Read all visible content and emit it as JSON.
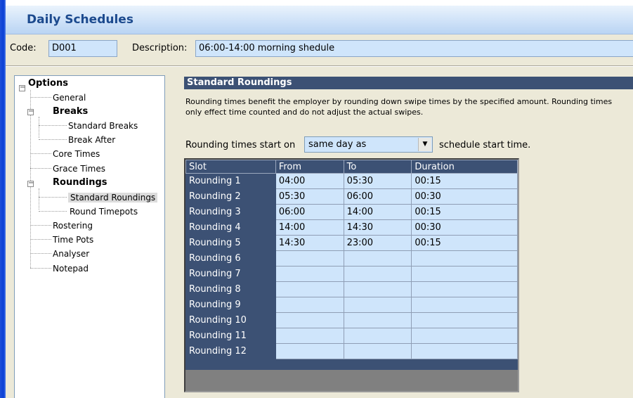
{
  "window": {
    "title": "Daily Schedules"
  },
  "header": {
    "code_label": "Code:",
    "code_value": "D001",
    "description_label": "Description:",
    "description_value": "06:00-14:00 morning shedule"
  },
  "tree": {
    "options": "Options",
    "general": "General",
    "breaks": "Breaks",
    "standard_breaks": "Standard Breaks",
    "break_after": "Break After",
    "core_times": "Core Times",
    "grace_times": "Grace Times",
    "roundings": "Roundings",
    "standard_roundings": "Standard Roundings",
    "round_timepots": "Round Timepots",
    "rostering": "Rostering",
    "time_pots": "Time Pots",
    "analyser": "Analyser",
    "notepad": "Notepad",
    "selected": "Standard Roundings"
  },
  "section": {
    "title": "Standard Roundings",
    "description_line1": "Rounding times benefit the employer by rounding down swipe times by the specified amount. Rounding times",
    "description_line2": "only effect time counted and do not adjust the actual swipes.",
    "start_label": "Rounding times start on",
    "start_value": "same day as",
    "start_suffix": "schedule start time."
  },
  "grid": {
    "columns": [
      "Slot",
      "From",
      "To",
      "Duration"
    ],
    "rows": [
      [
        "Rounding 1",
        "04:00",
        "05:30",
        "00:15"
      ],
      [
        "Rounding 2",
        "05:30",
        "06:00",
        "00:30"
      ],
      [
        "Rounding 3",
        "06:00",
        "14:00",
        "00:15"
      ],
      [
        "Rounding 4",
        "14:00",
        "14:30",
        "00:30"
      ],
      [
        "Rounding 5",
        "14:30",
        "23:00",
        "00:15"
      ],
      [
        "Rounding 6",
        "",
        "",
        ""
      ],
      [
        "Rounding 7",
        "",
        "",
        ""
      ],
      [
        "Rounding 8",
        "",
        "",
        ""
      ],
      [
        "Rounding 9",
        "",
        "",
        ""
      ],
      [
        "Rounding 10",
        "",
        "",
        ""
      ],
      [
        "Rounding 11",
        "",
        "",
        ""
      ],
      [
        "Rounding 12",
        "",
        "",
        ""
      ]
    ]
  },
  "icons": {
    "combo_arrow": "chevron-down-icon",
    "tree_toggle": "minus-icon"
  },
  "colors": {
    "header_navy": "#3c5174",
    "field_blue": "#cfe5fb",
    "title_blue": "#1c4a8e",
    "panel": "#ece9d8"
  }
}
